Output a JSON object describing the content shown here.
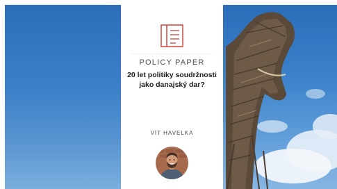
{
  "panel": {
    "kicker": "POLICY PAPER",
    "title_line1": "20 let politiky soudržnosti",
    "title_line2": "jako danajský dar?",
    "author": "VÍT HAVELKA"
  },
  "icons": {
    "document": "document-icon",
    "avatar": "author-avatar"
  },
  "colors": {
    "accent": "#d0453a",
    "sky": "#3c83cb",
    "panel": "#ffffff"
  }
}
